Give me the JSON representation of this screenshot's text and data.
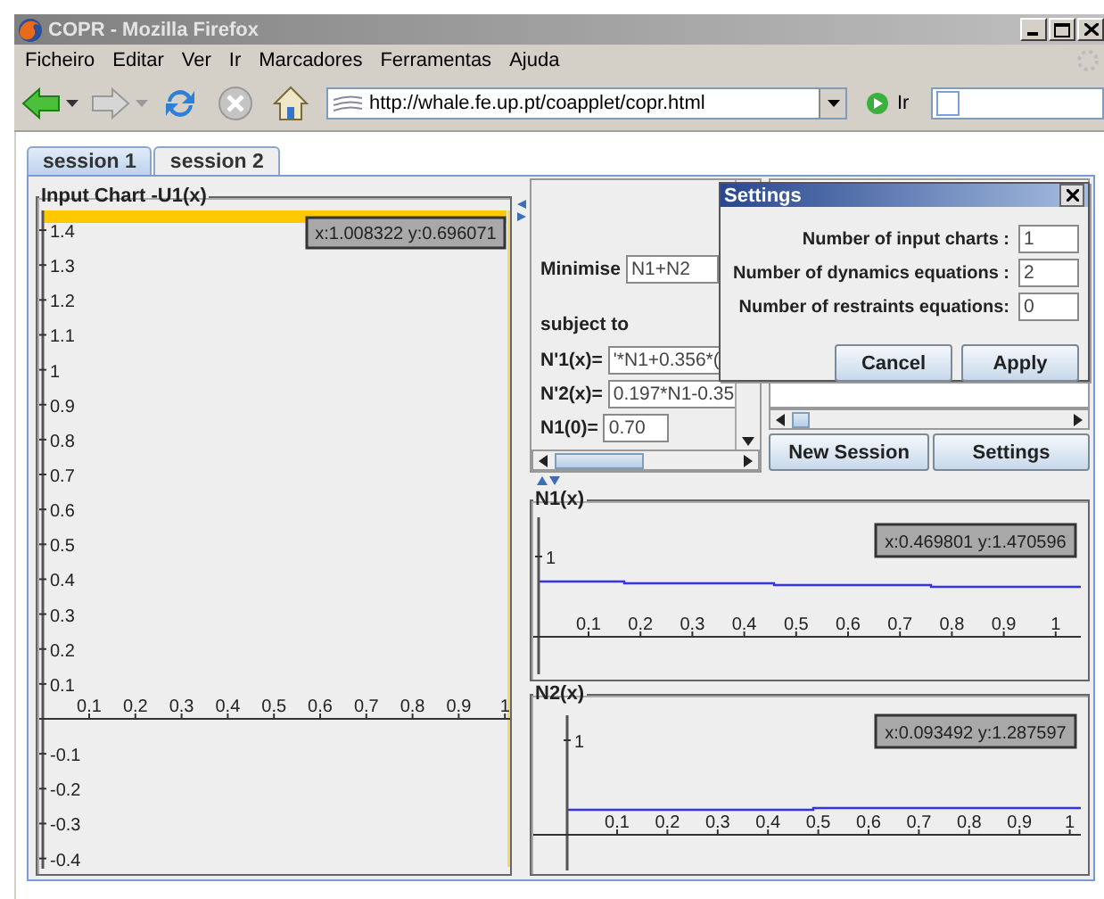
{
  "window": {
    "title": "COPR - Mozilla Firefox"
  },
  "menu": [
    "Ficheiro",
    "Editar",
    "Ver",
    "Ir",
    "Marcadores",
    "Ferramentas",
    "Ajuda"
  ],
  "toolbar": {
    "url": "http://whale.fe.up.pt/coapplet/copr.html",
    "go_label": "Ir"
  },
  "tabs": [
    {
      "label": "session 1",
      "selected": true
    },
    {
      "label": "session 2",
      "selected": false
    }
  ],
  "input_chart": {
    "title": "Input Chart -U1(x)",
    "y_ticks_above": [
      "1.4",
      "1.3",
      "1.2",
      "1.1",
      "1",
      "0.9",
      "0.8",
      "0.7",
      "0.6",
      "0.5",
      "0.4",
      "0.3",
      "0.2",
      "0.1"
    ],
    "y_ticks_below": [
      "-0.1",
      "-0.2",
      "-0.3",
      "-0.4"
    ],
    "x_ticks": [
      "0.1",
      "0.2",
      "0.3",
      "0.4",
      "0.5",
      "0.6",
      "0.7",
      "0.8",
      "0.9",
      "1"
    ],
    "readout": "x:1.008322 y:0.696071"
  },
  "editor": {
    "objective_label": "Minimise",
    "objective": "N1+N2",
    "constraint_heading": "subject to",
    "equations": [
      {
        "label": "N'1(x)=",
        "value": "'*N1+0.356*("
      },
      {
        "label": "N'2(x)=",
        "value": "0.197*N1-0.35"
      },
      {
        "label": "N1(0)=",
        "value": "0.70"
      }
    ]
  },
  "buttons": [
    "New Session",
    "Settings"
  ],
  "output_charts": [
    {
      "title": "N1(x)",
      "y_ticks": [
        "1"
      ],
      "x_ticks": [
        "0.1",
        "0.2",
        "0.3",
        "0.4",
        "0.5",
        "0.6",
        "0.7",
        "0.8",
        "0.9",
        "1"
      ],
      "readout": "x:0.469801 y:1.470596"
    },
    {
      "title": "N2(x)",
      "y_ticks": [
        "1"
      ],
      "x_ticks": [
        "0.1",
        "0.2",
        "0.3",
        "0.4",
        "0.5",
        "0.6",
        "0.7",
        "0.8",
        "0.9",
        "1"
      ],
      "readout": "x:0.093492 y:1.287597"
    }
  ],
  "dialog": {
    "title": "Settings",
    "fields": [
      {
        "label": "Number of input charts :",
        "value": "1"
      },
      {
        "label": "Number of dynamics equations :",
        "value": "2"
      },
      {
        "label": "Number of restraints equations:",
        "value": "0"
      }
    ],
    "buttons": [
      "Cancel",
      "Apply"
    ]
  }
}
